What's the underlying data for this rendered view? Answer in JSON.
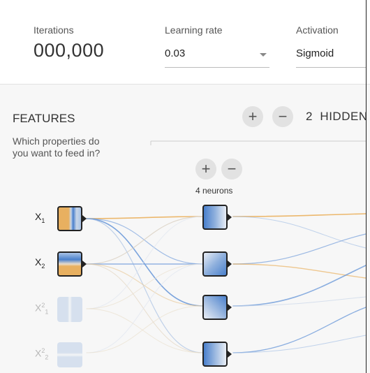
{
  "controls": {
    "iterations_label": "Iterations",
    "iterations_value": "000,000",
    "learning_rate_label": "Learning rate",
    "learning_rate_value": "0.03",
    "activation_label": "Activation",
    "activation_value": "Sigmoid"
  },
  "features": {
    "title": "FEATURES",
    "question": "Which properties do you want to feed in?",
    "inputs": [
      {
        "base": "X",
        "sub": "1",
        "sup": "",
        "active": true
      },
      {
        "base": "X",
        "sub": "2",
        "sup": "",
        "active": true
      },
      {
        "base": "X",
        "sub": "1",
        "sup": "2",
        "active": false
      },
      {
        "base": "X",
        "sub": "2",
        "sup": "2",
        "active": false
      }
    ]
  },
  "network": {
    "hidden_layers_count": "2",
    "hidden_layers_label": "HIDDEN",
    "add_layer": "+",
    "remove_layer": "−",
    "add_neuron": "+",
    "remove_neuron": "−",
    "layer1_neurons_label": "4 neurons"
  },
  "colors": {
    "positive": "#5b8ed6",
    "negative": "#e8a74a",
    "border": "#222222"
  }
}
